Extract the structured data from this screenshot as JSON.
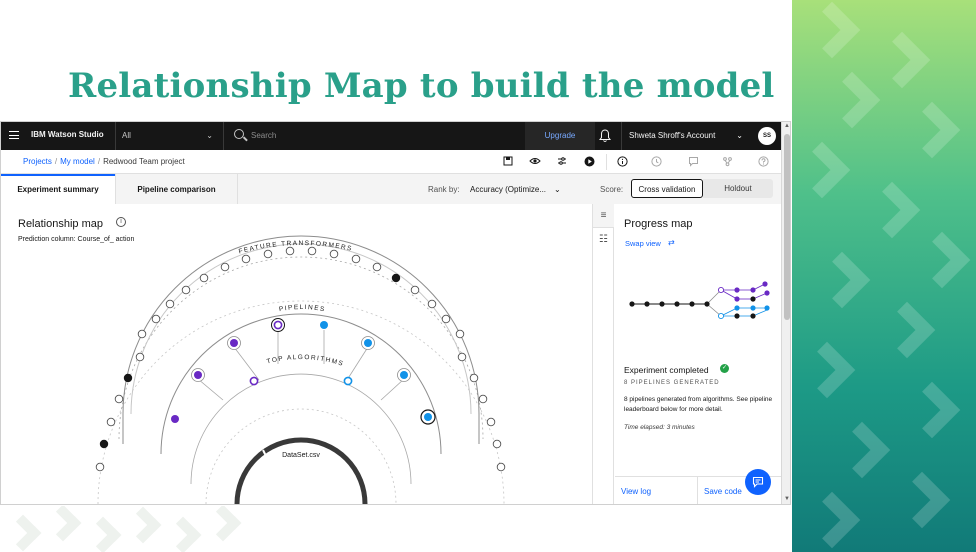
{
  "slide": {
    "title": "Relationship Map to build the model"
  },
  "topbar": {
    "brand": "IBM Watson Studio",
    "context": "All",
    "search_placeholder": "Search",
    "upgrade": "Upgrade",
    "account": "Shweta Shroff's Account",
    "avatar": "SS"
  },
  "breadcrumb": {
    "projects": "Projects",
    "my_model": "My model",
    "current": "Redwood Team project",
    "separator": "/"
  },
  "tabs": {
    "experiment_summary": "Experiment summary",
    "pipeline_comparison": "Pipeline comparison",
    "rank_label": "Rank by:",
    "rank_value": "Accuracy (Optimize...",
    "score_label": "Score:",
    "cross_validation": "Cross validation",
    "holdout": "Holdout"
  },
  "relationship_map": {
    "title": "Relationship map",
    "prediction": "Prediction column: Course_of_ action",
    "ring_feature": "FEATURE TRANSFORMERS",
    "ring_pipelines": "PIPELINES",
    "ring_algorithms": "TOP ALGORITHMS",
    "center": "DataSet.csv"
  },
  "progress_map": {
    "title": "Progress map",
    "swap_view": "Swap view",
    "status": "Experiment completed",
    "generated": "8 PIPELINES GENERATED",
    "description": "8 pipelines generated from algorithms. See pipeline leaderboard below for more detail.",
    "elapsed": "Time elapsed: 3 minutes",
    "view_log": "View log",
    "save_code": "Save code"
  },
  "colors": {
    "accent": "#2aa08a",
    "purple": "#6929c4",
    "blue": "#1192e8",
    "link": "#0f62fe"
  }
}
